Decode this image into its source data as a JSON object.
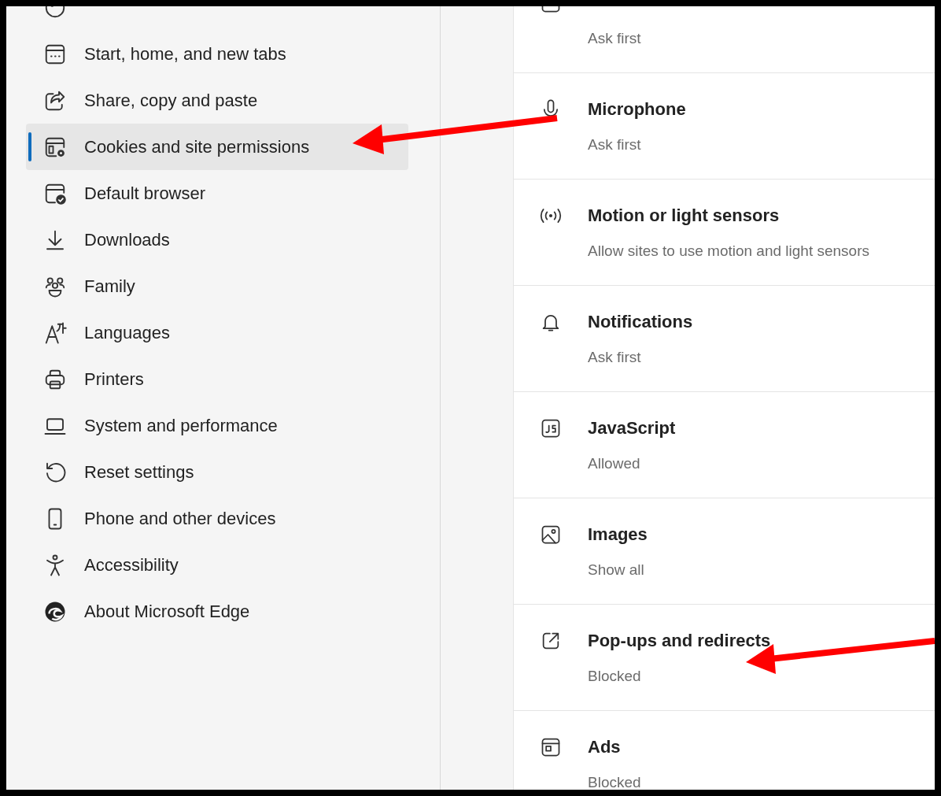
{
  "sidebar": {
    "items": [
      {
        "label": "Start, home, and new tabs",
        "selected": false
      },
      {
        "label": "Share, copy and paste",
        "selected": false
      },
      {
        "label": "Cookies and site permissions",
        "selected": true
      },
      {
        "label": "Default browser",
        "selected": false
      },
      {
        "label": "Downloads",
        "selected": false
      },
      {
        "label": "Family",
        "selected": false
      },
      {
        "label": "Languages",
        "selected": false
      },
      {
        "label": "Printers",
        "selected": false
      },
      {
        "label": "System and performance",
        "selected": false
      },
      {
        "label": "Reset settings",
        "selected": false
      },
      {
        "label": "Phone and other devices",
        "selected": false
      },
      {
        "label": "Accessibility",
        "selected": false
      },
      {
        "label": "About Microsoft Edge",
        "selected": false
      }
    ]
  },
  "permissions": [
    {
      "status": "Ask first"
    },
    {
      "title": "Microphone",
      "status": "Ask first"
    },
    {
      "title": "Motion or light sensors",
      "status": "Allow sites to use motion and light sensors"
    },
    {
      "title": "Notifications",
      "status": "Ask first"
    },
    {
      "title": "JavaScript",
      "status": "Allowed"
    },
    {
      "title": "Images",
      "status": "Show all"
    },
    {
      "title": "Pop-ups and redirects",
      "status": "Blocked"
    },
    {
      "title": "Ads",
      "status": "Blocked"
    }
  ]
}
